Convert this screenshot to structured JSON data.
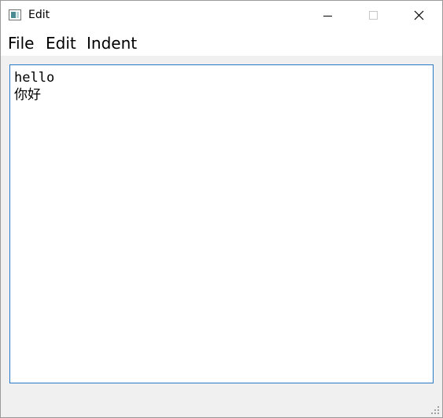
{
  "window": {
    "title": "Edit",
    "icon": "app-window-icon"
  },
  "controls": {
    "minimize_icon": "minimize-icon",
    "maximize_icon": "maximize-icon",
    "close_icon": "close-icon"
  },
  "menu": {
    "items": [
      {
        "label": "File"
      },
      {
        "label": "Edit"
      },
      {
        "label": "Indent"
      }
    ]
  },
  "editor": {
    "lines": [
      "hello",
      "你好"
    ],
    "border_color": "#2a78c8"
  },
  "status": {
    "grip_icon": "size-grip-icon"
  }
}
